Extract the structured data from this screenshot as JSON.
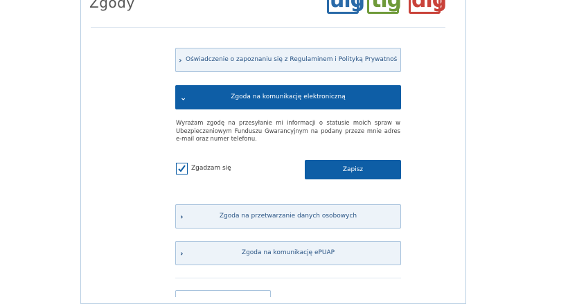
{
  "page": {
    "title": "Zgody",
    "logos": [
      {
        "text": "uig",
        "color": "#2a6aa8"
      },
      {
        "text": "tig",
        "color": "#6f9a3a"
      },
      {
        "text": "dig",
        "color": "#c9423a"
      }
    ]
  },
  "accordions": [
    {
      "label": "Oświadczenie o zapoznaniu się z Regulaminem i Polityką Prywatności",
      "expanded": false
    },
    {
      "label": "Zgoda na komunikację elektroniczną",
      "expanded": true
    },
    {
      "label": "Zgoda na przetwarzanie danych osobowych",
      "expanded": false
    },
    {
      "label": "Zgoda na komunikację ePUAP",
      "expanded": false
    }
  ],
  "consent": {
    "description": "Wyrażam zgodę na przesyłanie mi informacji o statusie moich spraw w Ubezpieczeniowym Funduszu Gwarancyjnym na podany przeze mnie adres e-mail oraz numer telefonu.",
    "checkbox_label": "Zgadzam się",
    "checked": true,
    "save_label": "Zapisz"
  },
  "icons": {
    "collapsed": "chevron-right-icon",
    "expanded": "chevron-down-icon",
    "check": "check-icon"
  },
  "colors": {
    "primary": "#0e5ea6",
    "accordion_bg": "#edf3f9",
    "accordion_border": "#a8c3dd"
  }
}
